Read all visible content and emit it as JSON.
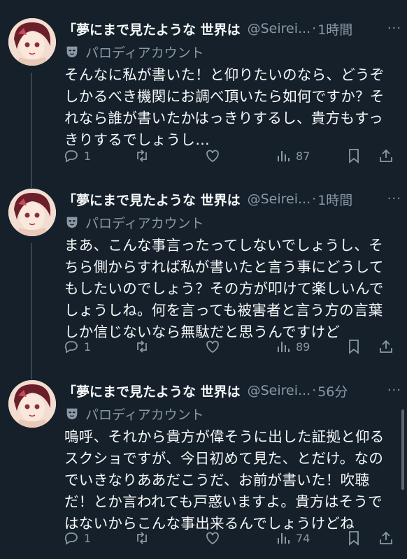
{
  "tweets": [
    {
      "display_name": "「夢にまで見たような 世界は",
      "handle": "@Seirei...",
      "time": "1時間",
      "parody_label": "パロディアカウント",
      "text": "そんなに私が書いた！と仰りたいのなら、どうぞしかるべき機関にお調べ頂いたら如何ですか？それなら誰が書いたかはっきりするし、貴方もすっきりするでしょうし…",
      "reply_count": "1",
      "view_count": "87"
    },
    {
      "display_name": "「夢にまで見たような 世界は",
      "handle": "@Seirei...",
      "time": "1時間",
      "parody_label": "パロディアカウント",
      "text": "まあ、こんな事言ったってしないでしょうし、そちら側からすれば私が書いたと言う事にどうしてもしたいのでしょう？その方が叩けて楽しいんでしょうしね。何を言っても被害者と言う方の言葉しか信じないなら無駄だと思うんですけど",
      "reply_count": "1",
      "view_count": "89"
    },
    {
      "display_name": "「夢にまで見たような 世界は",
      "handle": "@Seirei...",
      "time": "56分",
      "parody_label": "パロディアカウント",
      "text": "嗚呼、それから貴方が偉そうに出した証拠と仰るスクショですが、今日初めて見た、とだけ。なのでいきなりああだこうだ、お前が書いた！吹聴だ！とか言われても戸惑いますよ。貴方はそうではないからこんな事出来るんでしょうけどね",
      "reply_count": "1",
      "view_count": "74"
    }
  ],
  "separator": "·",
  "more_glyph": "···",
  "colors": {
    "background": "#15202b",
    "text": "#f7f9f9",
    "muted": "#8b98a5"
  }
}
